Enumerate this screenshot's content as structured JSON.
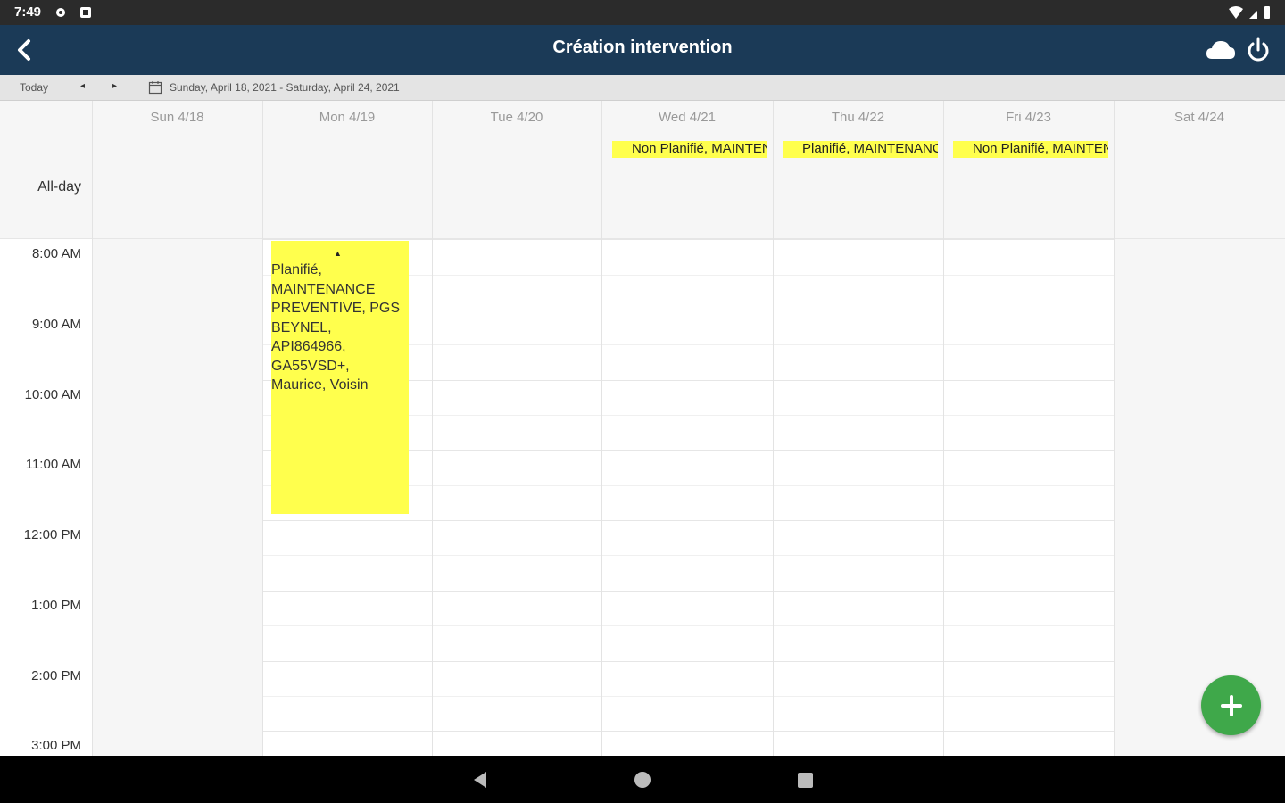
{
  "status_bar": {
    "time": "7:49"
  },
  "app_bar": {
    "title": "Création intervention"
  },
  "toolbar": {
    "today_label": "Today",
    "prev_label": "◂",
    "next_label": "▸",
    "date_range": "Sunday, April 18, 2021 - Saturday, April 24, 2021"
  },
  "calendar": {
    "days": [
      "Sun 4/18",
      "Mon 4/19",
      "Tue 4/20",
      "Wed 4/21",
      "Thu 4/22",
      "Fri 4/23",
      "Sat 4/24"
    ],
    "allday_label": "All-day",
    "allday_events": [
      {
        "day": "Wed 4/21",
        "text": "Non Planifié, MAINTENANCE"
      },
      {
        "day": "Thu 4/22",
        "text": "Planifié, MAINTENANCE"
      },
      {
        "day": "Fri 4/23",
        "text": "Non Planifié, MAINTENANCE"
      }
    ],
    "time_labels": [
      "8:00 AM",
      "9:00 AM",
      "10:00 AM",
      "11:00 AM",
      "12:00 PM",
      "1:00 PM",
      "2:00 PM",
      "3:00 PM"
    ],
    "event": {
      "day": "Mon 4/19",
      "lines": [
        "Planifié,",
        "MAINTENANCE",
        "PREVENTIVE, PGS",
        "BEYNEL,",
        "API864966,",
        "GA55VSD+,",
        "Maurice, Voisin"
      ]
    }
  },
  "colors": {
    "app_bar": "#1b3a57",
    "event_yellow": "#ffff4d",
    "fab_green": "#3fa84a"
  },
  "icons": {
    "back": "back-arrow-icon",
    "cloud": "cloud-icon",
    "power": "power-icon",
    "calendar": "calendar-icon",
    "fab": "plus-icon"
  }
}
